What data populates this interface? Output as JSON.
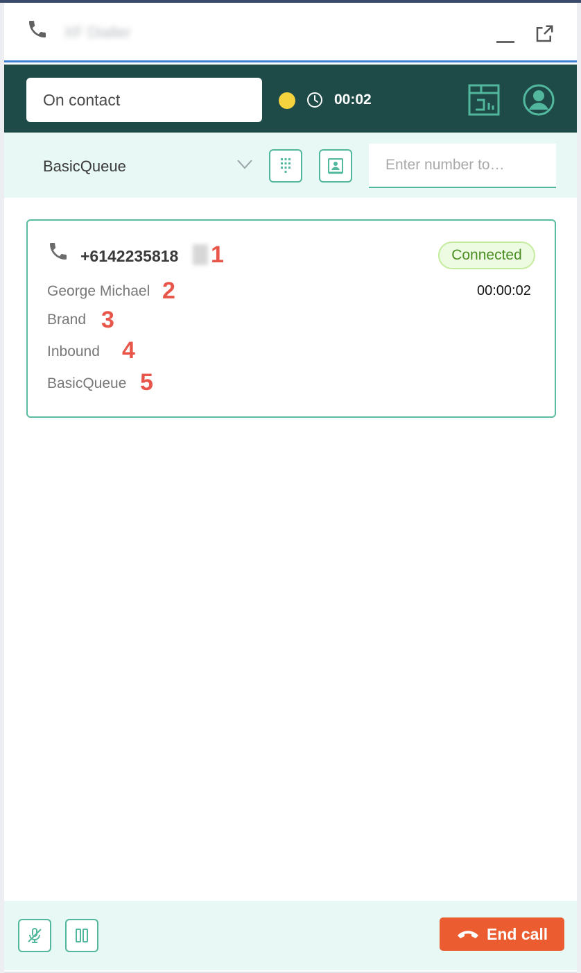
{
  "window": {
    "title": "XF Dialler"
  },
  "status": {
    "current": "On contact",
    "timer": "00:02",
    "indicator_color": "#f5d33f"
  },
  "dial": {
    "queue": "BasicQueue",
    "number_placeholder": "Enter number to…"
  },
  "contact": {
    "phone": "+6142235818",
    "name": "George Michael",
    "brand": "Brand",
    "direction": "Inbound",
    "queue": "BasicQueue",
    "status": "Connected",
    "duration": "00:00:02"
  },
  "annotations": [
    "1",
    "2",
    "3",
    "4",
    "5"
  ],
  "controls": {
    "end_call_label": "End call"
  },
  "colors": {
    "header_bg": "#1e4a48",
    "accent": "#52b89d",
    "end_call": "#ec5c31",
    "panel_bg": "#e8f8f4"
  },
  "icons": [
    "phone-icon",
    "minimize-icon",
    "popout-icon",
    "clock-icon",
    "report-icon",
    "profile-icon",
    "chevron-down-icon",
    "dialpad-icon",
    "contacts-icon",
    "mute-icon",
    "hold-icon",
    "end-call-icon"
  ]
}
